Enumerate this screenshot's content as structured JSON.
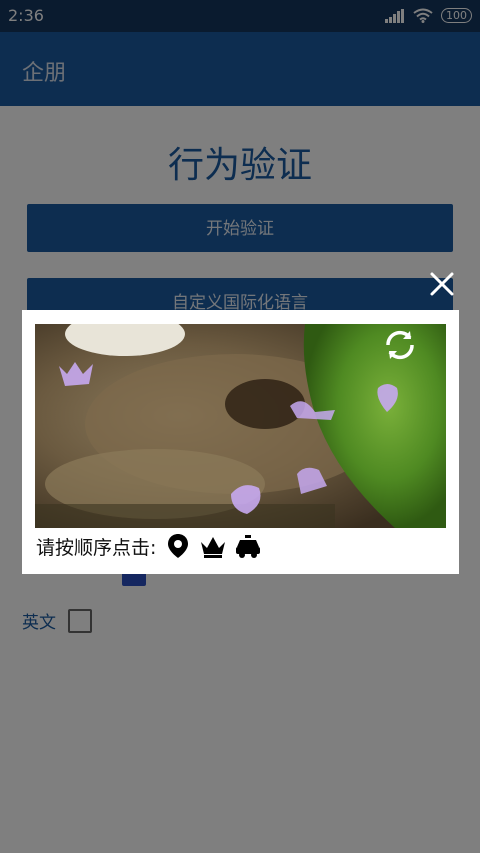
{
  "status_bar": {
    "time": "2:36",
    "battery": "100"
  },
  "app_bar": {
    "title": "企朋"
  },
  "page": {
    "title": "行为验证",
    "start_button": "开始验证",
    "i18n_button": "自定义国际化语言",
    "languages": [
      {
        "label": "英文",
        "checked": false
      }
    ]
  },
  "captcha": {
    "prompt": "请按顺序点击:",
    "targets": [
      "location-pin-icon",
      "crown-icon",
      "car-icon"
    ]
  }
}
